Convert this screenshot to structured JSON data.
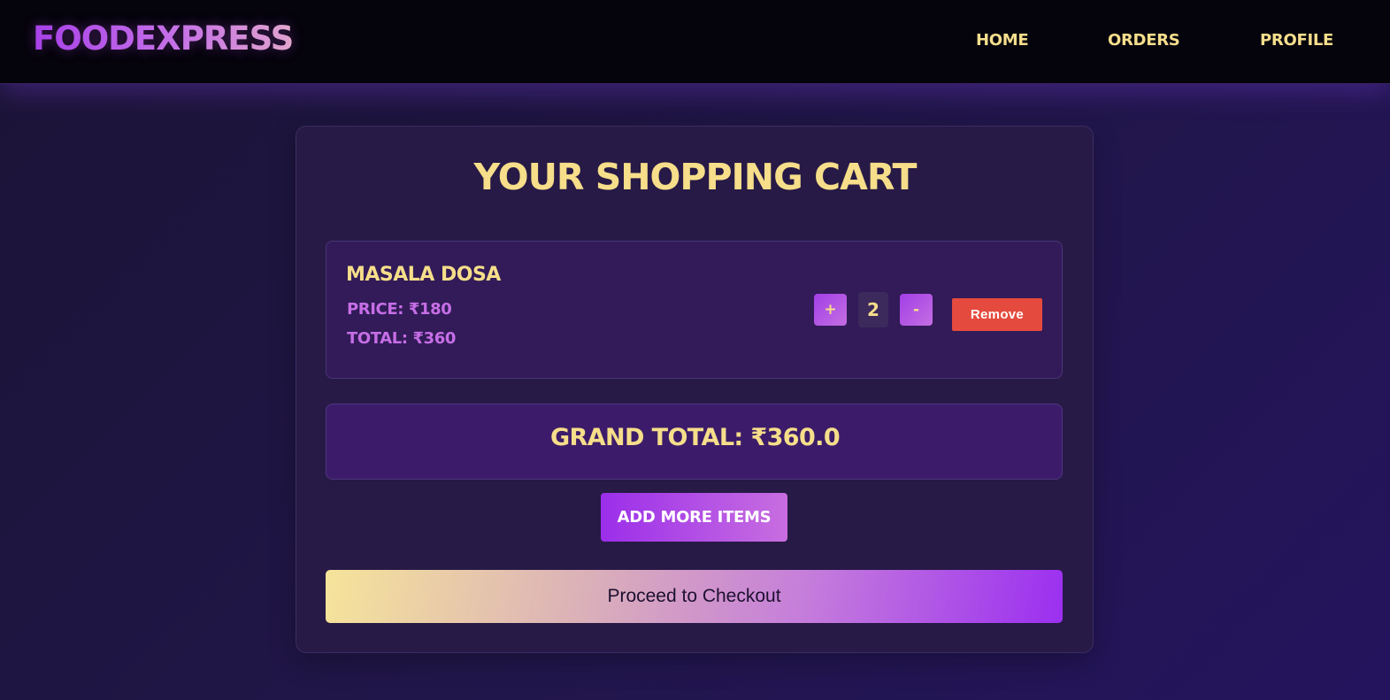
{
  "navbar": {
    "logo": "FOODEXPRESS",
    "links": [
      {
        "label": "HOME"
      },
      {
        "label": "ORDERS"
      },
      {
        "label": "PROFILE"
      }
    ]
  },
  "cart": {
    "title": "YOUR SHOPPING CART",
    "items": [
      {
        "name": "MASALA DOSA",
        "price_text": "PRICE: ₹180",
        "total_text": "TOTAL: ₹360",
        "increment_label": "+",
        "quantity": "2",
        "decrement_label": "-",
        "remove_label": "Remove"
      }
    ],
    "grand_total_text": "GRAND TOTAL: ₹360.0",
    "add_more_label": "ADD MORE ITEMS",
    "checkout_label": "Proceed to Checkout"
  },
  "colors": {
    "accent_yellow": "#f6de8a",
    "accent_purple": "#a13fe6",
    "remove_red": "#e44a3d",
    "background": "#1e1640"
  }
}
